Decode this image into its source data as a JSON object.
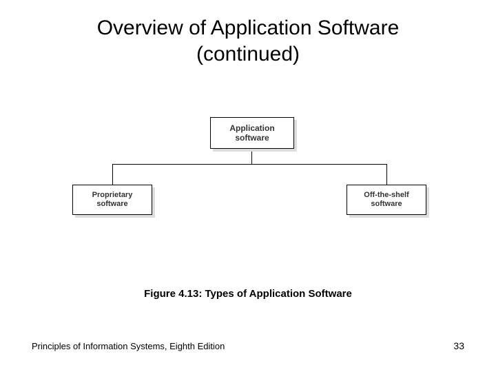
{
  "title_line1": "Overview of Application Software",
  "title_line2": "(continued)",
  "diagram": {
    "root_line1": "Application",
    "root_line2": "software",
    "left_line1": "Proprietary",
    "left_line2": "software",
    "right_line1": "Off-the-shelf",
    "right_line2": "software"
  },
  "caption": "Figure 4.13: Types of Application Software",
  "footer_left": "Principles of Information Systems, Eighth Edition",
  "footer_right": "33"
}
